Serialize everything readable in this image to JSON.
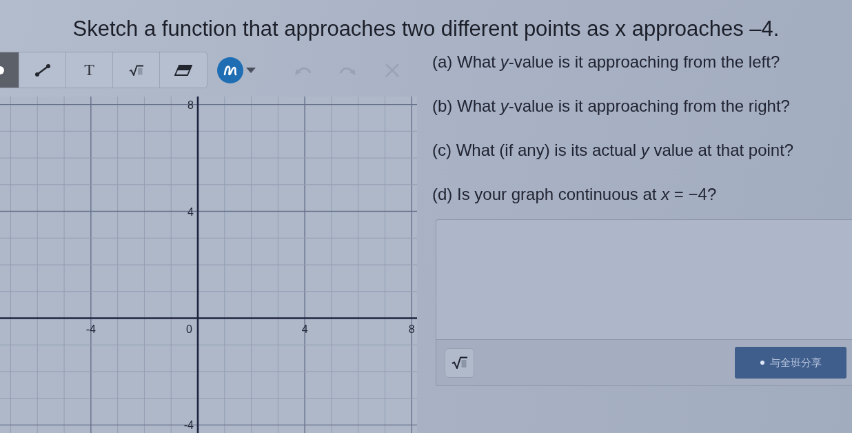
{
  "title": "Sketch a function that approaches two different points as x approaches –4.",
  "toolbar": {
    "tools": [
      {
        "kind": "pen",
        "selected": true
      },
      {
        "kind": "line",
        "selected": false
      },
      {
        "kind": "text",
        "glyph": "T",
        "selected": false
      },
      {
        "kind": "math",
        "selected": false
      },
      {
        "kind": "eraser",
        "selected": false
      }
    ],
    "actions": [
      {
        "kind": "undo",
        "disabled": true
      },
      {
        "kind": "redo",
        "disabled": true
      },
      {
        "kind": "clear",
        "disabled": true
      }
    ]
  },
  "graph": {
    "origin_label": "0",
    "chart_data": {
      "type": "line",
      "grid": true,
      "xlim": [
        -7.4,
        8.2
      ],
      "ylim": [
        -4.3,
        8.3
      ],
      "xticks": [
        {
          "value": -4,
          "label": "-4"
        },
        {
          "value": 4,
          "label": "4"
        },
        {
          "value": 8,
          "label": "8"
        }
      ],
      "yticks": [
        {
          "value": 8,
          "label": "8"
        },
        {
          "value": 4,
          "label": "4"
        },
        {
          "value": -4,
          "label": "-4"
        }
      ]
    }
  },
  "questions": [
    "(a) What *y*-value is it approaching from the left?",
    "(b) What *y*-value is it approaching from the right?",
    "(c) What (if any) is its actual *y* value at that point?",
    "(d) Is your graph continuous at *x* = −4?"
  ],
  "answer": {
    "share_button": "与全班分享"
  }
}
